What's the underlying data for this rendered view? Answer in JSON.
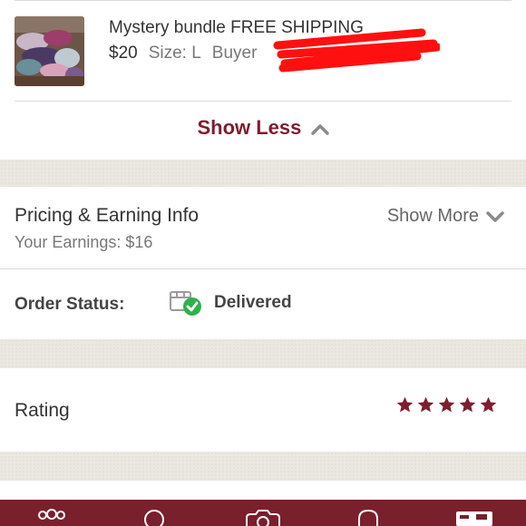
{
  "item": {
    "title": "Mystery bundle FREE SHIPPING",
    "price": "$20",
    "size": "Size: L",
    "buyer_label": "Buyer"
  },
  "show_less_label": "Show Less",
  "pricing": {
    "title": "Pricing & Earning Info",
    "earnings": "Your Earnings: $16",
    "show_more_label": "Show More"
  },
  "order_status": {
    "label": "Order Status:",
    "value": "Delivered"
  },
  "rating": {
    "label": "Rating",
    "stars": 5,
    "max_stars": 5
  },
  "colors": {
    "accent": "#7f1d2e",
    "nav_bg": "#7a1f2c",
    "status_check": "#2fb24a",
    "redaction": "#ff1010"
  },
  "icons": {
    "status": "package-check-icon",
    "show_less": "chevron-up-icon",
    "show_more": "chevron-down-icon",
    "rating": "star-icon",
    "nav": [
      "community-icon",
      "search-icon",
      "camera-icon",
      "notifications-icon",
      "account-icon"
    ]
  }
}
